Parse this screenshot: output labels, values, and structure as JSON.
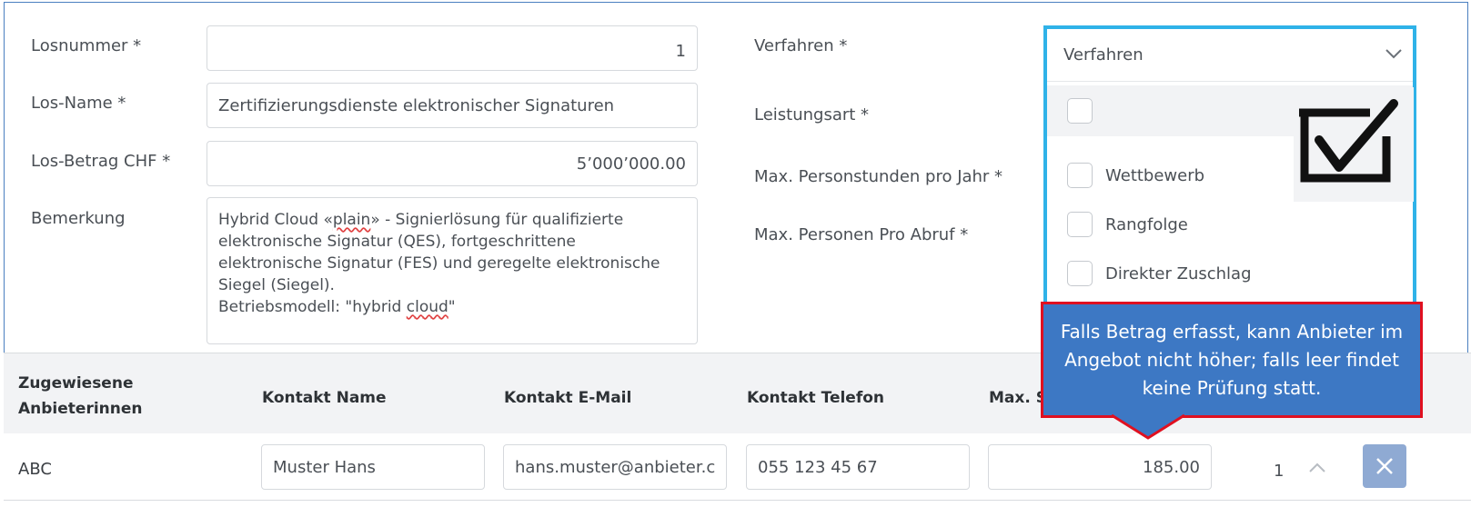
{
  "form": {
    "losnummer": {
      "label": "Losnummer *",
      "value": "1"
    },
    "los_name": {
      "label": "Los-Name *",
      "value": "Zertifizierungsdienste elektronischer Signaturen"
    },
    "los_betrag": {
      "label": "Los-Betrag CHF *",
      "value": "5’000’000.00"
    },
    "bemerkung": {
      "label": "Bemerkung",
      "line1_pre": "Hybrid Cloud «",
      "line1_word": "plain",
      "line1_post": "» - Signierlösung für qualifizierte",
      "line2": "elektronische Signatur (QES), fortgeschrittene",
      "line3": "elektronische Signatur (FES) und geregelte elektronische",
      "line4": "Siegel (Siegel).",
      "line5_pre": "Betriebsmodell: \"hybrid ",
      "line5_word": "cloud",
      "line5_post": "\""
    },
    "verfahren": {
      "label": "Verfahren *",
      "selected": "Verfahren"
    },
    "leistungsart": {
      "label": "Leistungsart *"
    },
    "max_personstunden": {
      "label": "Max. Personstunden pro Jahr *"
    },
    "max_personen": {
      "label": "Max. Personen Pro Abruf *"
    }
  },
  "dropdown": {
    "options": [
      "",
      "Wettbewerb",
      "Rangfolge",
      "Direkter Zuschlag"
    ]
  },
  "tooltip": {
    "text": "Falls Betrag erfasst, kann Anbieter im Angebot nicht höher; falls leer findet keine Prüfung statt."
  },
  "table": {
    "headers": {
      "anbieter_1": "Zugewiesene",
      "anbieter_2": "Anbieterinnen",
      "kontakt_name": "Kontakt Name",
      "kontakt_email": "Kontakt E-Mail",
      "kontakt_telefon": "Kontakt Telefon",
      "max": "Max. S"
    },
    "rows": [
      {
        "anbieter": "ABC",
        "kontakt_name": "Muster Hans",
        "kontakt_email": "hans.muster@anbieter.c",
        "kontakt_telefon": "055 123 45 67",
        "max_value": "185.00",
        "order": "1"
      }
    ]
  },
  "icons": {
    "dropdown_chevron": "chevron-down-icon",
    "checkmark": "checkmark-icon",
    "move_up": "chevron-up-icon",
    "delete": "close-icon"
  },
  "colors": {
    "frame_border": "#4a7fc0",
    "dropdown_border": "#2fb2e8",
    "tooltip_bg": "#3d78c4",
    "tooltip_border": "#e01020",
    "delete_bg": "#8faad3",
    "table_header_bg": "#f2f3f5"
  }
}
